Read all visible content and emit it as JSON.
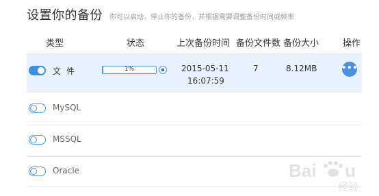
{
  "header": {
    "title": "设置你的备份",
    "subtitle": "你可以启动，停止你的备份，并根据需要调整备份时间或频率"
  },
  "columns": {
    "type": "类型",
    "status": "状态",
    "last_backup": "上次备份时间",
    "file_count": "备份文件数",
    "size": "备份大小",
    "ops": "操作"
  },
  "rows": [
    {
      "type": "文件",
      "enabled": true,
      "progress_text": "1%",
      "progress": 1,
      "date": "2015-05-11",
      "time": "16:07:59",
      "count": "7",
      "size": "8.12MB"
    },
    {
      "type": "MySQL",
      "enabled": false
    },
    {
      "type": "MSSQL",
      "enabled": false
    },
    {
      "type": "Oracle",
      "enabled": false
    }
  ],
  "colors": {
    "accent": "#4a90e2",
    "active_row_bg": "#e9f1fc"
  },
  "watermark": "Baidu 经验"
}
